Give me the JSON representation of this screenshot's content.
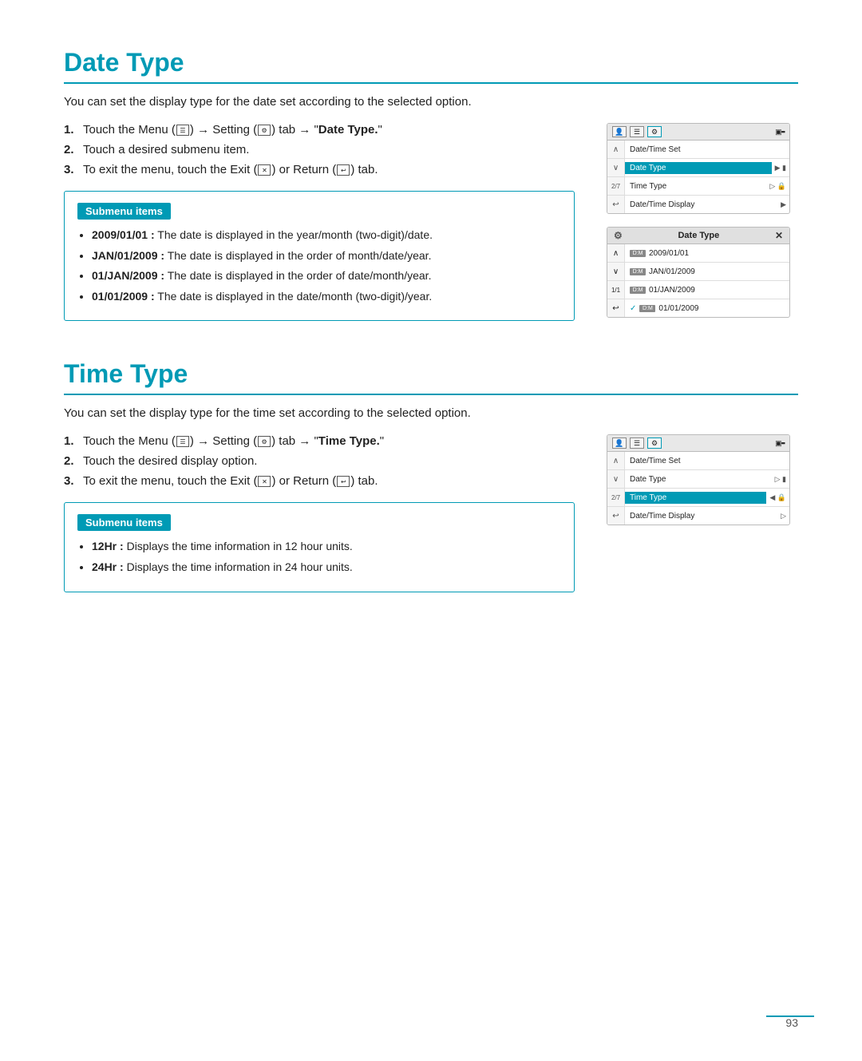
{
  "page": {
    "page_number": "93"
  },
  "date_type_section": {
    "title": "Date Type",
    "description": "You can set the display type for the date set according to the selected option.",
    "steps": [
      {
        "number": "1.",
        "text_before": "Touch the Menu (",
        "icon1": "menu-icon",
        "text_middle1": ") ",
        "arrow": "→",
        "text_setting": " Setting (",
        "icon2": "gear-icon",
        "text_middle2": ") tab ",
        "arrow2": "→",
        "text_quoted": " \"Date Type.\""
      },
      {
        "number": "2.",
        "text": "Touch a desired submenu item."
      },
      {
        "number": "3.",
        "text_before": "To exit the menu, touch the Exit (",
        "icon3": "x-icon",
        "text_middle": ") or Return (",
        "icon4": "return-icon",
        "text_after": ") tab."
      }
    ],
    "submenu": {
      "header": "Submenu items",
      "items": [
        {
          "key": "2009/01/01",
          "description": "The date is displayed in the year/month (two-digit)/date."
        },
        {
          "key": "JAN/01/2009",
          "description": "The date is displayed in the order of month/date/year."
        },
        {
          "key": "01/JAN/2009",
          "description": "The date is displayed in the order of date/month/year."
        },
        {
          "key": "01/01/2009",
          "description": "The date is displayed in the date/month (two-digit)/year."
        }
      ]
    },
    "ui_screen1": {
      "header_icons": [
        "person-icon",
        "menu-icon",
        "gear-icon",
        "battery-icon"
      ],
      "rows": [
        {
          "nav": "∧",
          "label": "Date/Time Set",
          "value": "",
          "highlighted": false
        },
        {
          "nav": "∨",
          "label": "Date Type",
          "value": "▶ ▶▮",
          "highlighted": true
        },
        {
          "nav": "2/7",
          "label": "Time Type",
          "value": "▷ 🔒",
          "highlighted": false
        },
        {
          "nav": "↩",
          "label": "Date/Time Display",
          "value": "▶ 5̄3̄",
          "highlighted": false
        }
      ]
    },
    "ui_popup": {
      "header": "Date Type",
      "header_icon": "gear-icon",
      "close": "✕",
      "rows": [
        {
          "nav": "∧",
          "date_icon": "D:M",
          "value": "2009/01/01",
          "selected": false,
          "counter": ""
        },
        {
          "nav": "∨",
          "date_icon": "D:M",
          "value": "JAN/01/2009",
          "selected": false,
          "counter": ""
        },
        {
          "nav": "1/1",
          "date_icon": "D:M",
          "value": "01/JAN/2009",
          "selected": false,
          "counter": ""
        },
        {
          "nav": "↩",
          "date_icon": "D:M",
          "value": "✓ 01/01/2009",
          "selected": true,
          "counter": ""
        }
      ]
    }
  },
  "time_type_section": {
    "title": "Time Type",
    "description": "You can set the display type for the time set according to the selected option.",
    "steps": [
      {
        "number": "1.",
        "text_before": "Touch the Menu (",
        "icon1": "menu-icon",
        "text_middle1": ") ",
        "arrow": "→",
        "text_setting": " Setting (",
        "icon2": "gear-icon",
        "text_middle2": ") tab ",
        "arrow2": "→",
        "text_quoted": " \"Time Type.\""
      },
      {
        "number": "2.",
        "text": "Touch the desired display option."
      },
      {
        "number": "3.",
        "text_before": "To exit the menu, touch the Exit (",
        "icon3": "x-icon",
        "text_middle": ") or Return (",
        "icon4": "return-icon",
        "text_after": ") tab."
      }
    ],
    "submenu": {
      "header": "Submenu items",
      "items": [
        {
          "key": "12Hr",
          "description": "Displays the time information in 12 hour units."
        },
        {
          "key": "24Hr",
          "description": "Displays the time information in 24 hour units."
        }
      ]
    },
    "ui_screen2": {
      "rows": [
        {
          "nav": "∧",
          "label": "Date/Time Set",
          "value": "",
          "highlighted": false
        },
        {
          "nav": "∨",
          "label": "Date Type",
          "value": "▷ ▶▮",
          "highlighted": false
        },
        {
          "nav": "2/7",
          "label": "Time Type",
          "value": "◀ 🔒",
          "highlighted": true
        },
        {
          "nav": "↩",
          "label": "Date/Time Display",
          "value": "▷ 5̄3̄",
          "highlighted": false
        }
      ]
    }
  }
}
